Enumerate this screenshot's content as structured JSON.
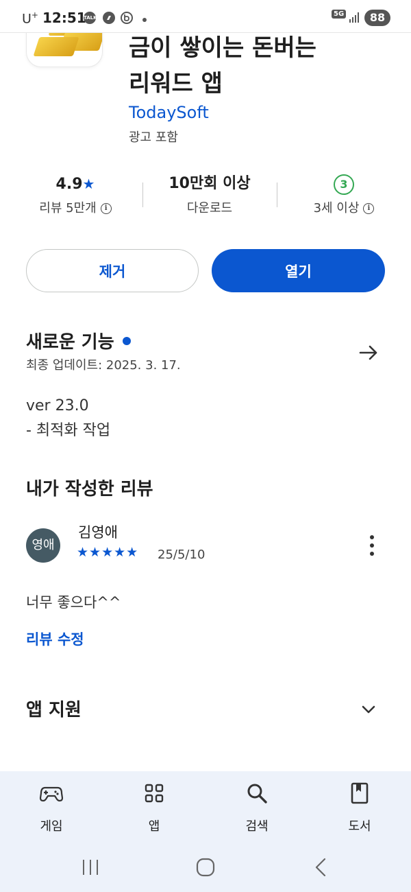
{
  "status_bar": {
    "carrier": "U",
    "carrier_sup": "+",
    "time": "12:51",
    "talk_icon_text": "TALK",
    "network": "5G",
    "battery": "88"
  },
  "app": {
    "title_line1": "금이 쌓이는 돈버는",
    "title_line2": "리워드 앱",
    "developer": "TodaySoft",
    "ads_label": "광고 포함"
  },
  "stats": {
    "rating": "4.9",
    "rating_star": "★",
    "reviews_label": "리뷰 5만개",
    "downloads": "10만회 이상",
    "downloads_label": "다운로드",
    "age_badge": "3",
    "age_label": "3세 이상"
  },
  "buttons": {
    "remove": "제거",
    "open": "열기"
  },
  "whats_new": {
    "title": "새로운 기능",
    "updated": "최종 업데이트: 2025. 3. 17.",
    "notes_line1": "ver 23.0",
    "notes_line2": "- 최적화 작업"
  },
  "my_review": {
    "title": "내가 작성한 리뷰",
    "avatar_text": "영애",
    "reviewer": "김영애",
    "stars": "★★★★★",
    "rating_value": 5,
    "date": "25/5/10",
    "text": "너무 좋으다^^",
    "edit_label": "리뷰 수정"
  },
  "app_support": {
    "title": "앱 지원"
  },
  "bottom_nav": {
    "items": [
      {
        "label": "게임",
        "icon": "gamepad-icon"
      },
      {
        "label": "앱",
        "icon": "apps-grid-icon"
      },
      {
        "label": "검색",
        "icon": "search-icon"
      },
      {
        "label": "도서",
        "icon": "book-icon"
      }
    ]
  },
  "colors": {
    "accent": "#0b57d0",
    "age_badge": "#34a853",
    "nav_background": "#edf2fa",
    "avatar": "#455a64"
  }
}
